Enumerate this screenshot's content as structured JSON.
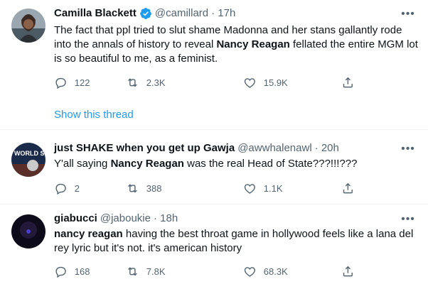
{
  "tweets": [
    {
      "name": "Camilla Blackett",
      "verified": true,
      "handle": "@camillard",
      "time": "· 17h",
      "text_parts": [
        "The fact that ppl tried to slut shame Madonna and her stans gallantly rode into the annals of history to reveal ",
        "Nancy Reagan",
        " fellated the entire MGM lot is so beautiful to me, as a feminist."
      ],
      "replies": "122",
      "retweets": "2.3K",
      "likes": "15.9K",
      "show_thread": "Show this thread"
    },
    {
      "name": "just SHAKE when you get up Gawja",
      "handle": "@awwhalenawl",
      "time": "· 20h",
      "avatar_text": "WORLD SERI",
      "text_parts": [
        "Y'all saying ",
        "Nancy Reagan",
        " was the real Head of State???!!!???"
      ],
      "replies": "2",
      "retweets": "388",
      "likes": "1.1K"
    },
    {
      "name": "giabucci",
      "handle": "@jaboukie",
      "time": "· 18h",
      "text_parts": [
        "nancy reagan",
        " having the best throat game in hollywood feels like a lana del rey lyric but it's not. it's american history"
      ],
      "replies": "168",
      "retweets": "7.8K",
      "likes": "68.3K"
    }
  ],
  "icons": {
    "reply": "reply-icon",
    "retweet": "retweet-icon",
    "like": "heart-icon",
    "share": "share-icon",
    "more": "more-icon",
    "verified": "verified-badge-icon"
  },
  "colors": {
    "link": "#1d9bf0",
    "muted": "#536471",
    "verified": "#1d9bf0"
  }
}
